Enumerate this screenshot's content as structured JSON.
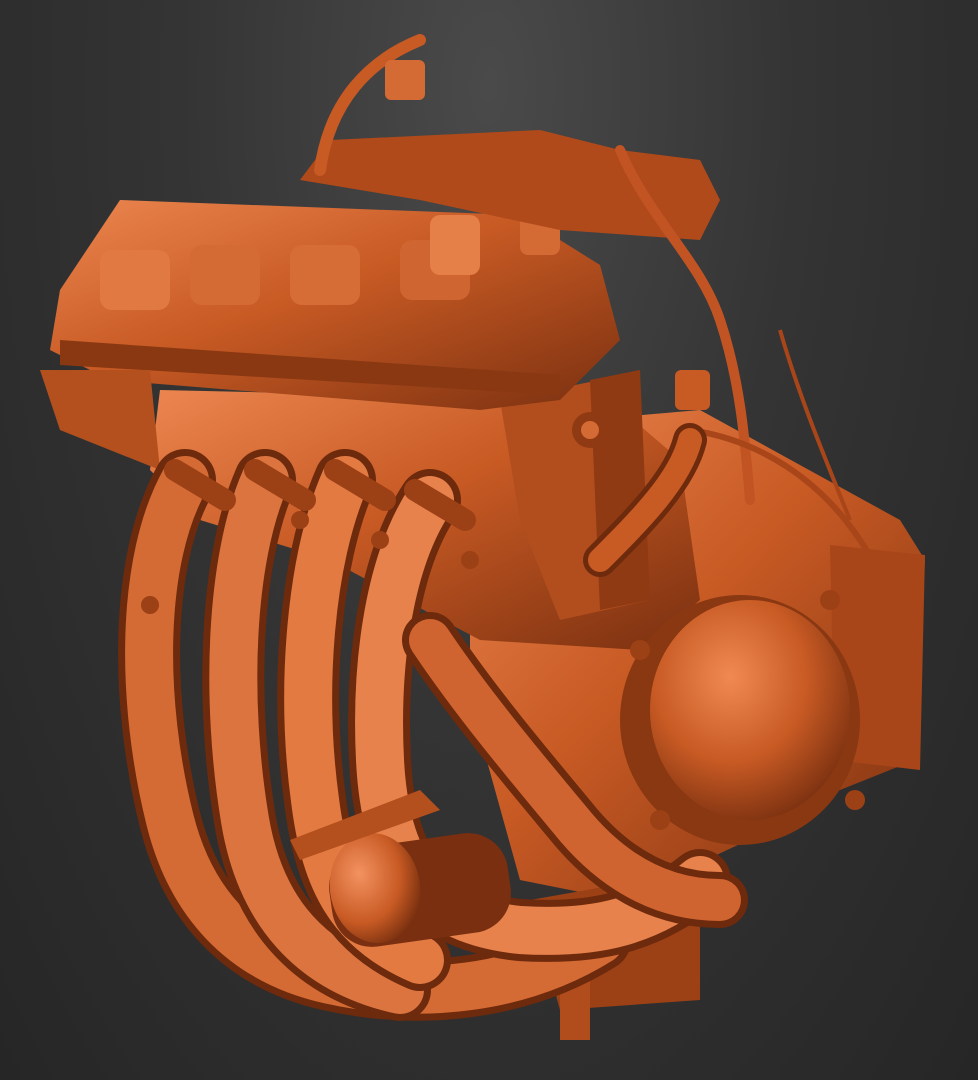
{
  "scene": {
    "subject": "engine-scan",
    "background_color": "#2f2f2f",
    "material_color": "#c85a24",
    "material_shadow_color": "#6e2a0c",
    "material_highlight_color": "#f08a52"
  }
}
